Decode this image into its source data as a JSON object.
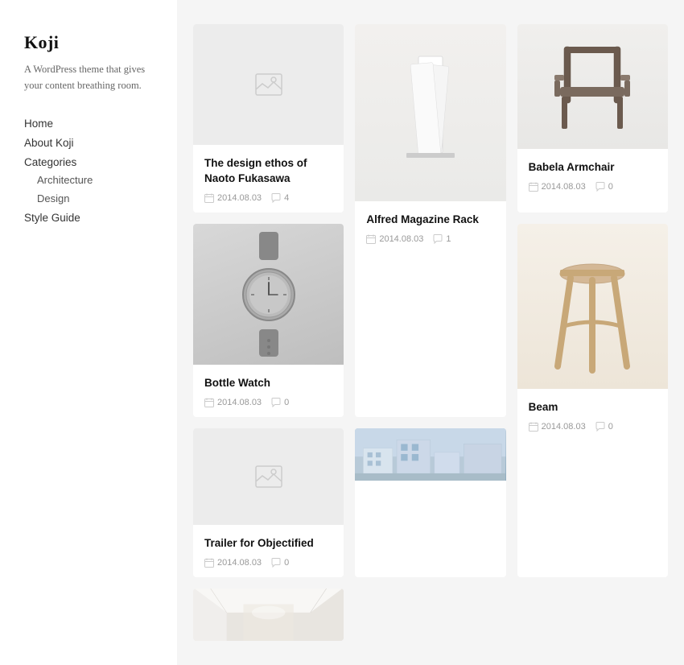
{
  "site": {
    "title": "Koji",
    "description": "A WordPress theme that gives your content breathing room."
  },
  "nav": {
    "items": [
      {
        "label": "Home",
        "href": "#"
      },
      {
        "label": "About Koji",
        "href": "#"
      }
    ],
    "categories_label": "Categories",
    "sub_items": [
      {
        "label": "Architecture",
        "href": "#"
      },
      {
        "label": "Design",
        "href": "#"
      }
    ],
    "style_guide": "Style Guide"
  },
  "cards": [
    {
      "id": "card-1",
      "title": "The design ethos of Naoto Fukasawa",
      "date": "2014.08.03",
      "comments": "4",
      "image_type": "placeholder",
      "col": 1
    },
    {
      "id": "card-2",
      "title": "Alfred Magazine Rack",
      "date": "2014.08.03",
      "comments": "1",
      "image_type": "magazine",
      "col": 2
    },
    {
      "id": "card-3",
      "title": "Babela Armchair",
      "date": "2014.08.03",
      "comments": "0",
      "image_type": "chair",
      "col": 3
    },
    {
      "id": "card-4",
      "title": "Bottle Watch",
      "date": "2014.08.03",
      "comments": "0",
      "image_type": "watch",
      "col": 1
    },
    {
      "id": "card-5",
      "title": "Beam",
      "date": "2014.08.03",
      "comments": "0",
      "image_type": "beam",
      "col": 2
    },
    {
      "id": "card-6",
      "title": "Trailer for Objectified",
      "date": "2014.08.03",
      "comments": "0",
      "image_type": "placeholder",
      "col": 3
    },
    {
      "id": "card-7",
      "title": "",
      "date": "",
      "comments": "",
      "image_type": "architecture",
      "col": 1
    },
    {
      "id": "card-8",
      "title": "",
      "date": "",
      "comments": "",
      "image_type": "corridor",
      "col": 3
    }
  ],
  "icons": {
    "calendar": "📅",
    "comment": "💬",
    "image_placeholder": "🖼"
  }
}
